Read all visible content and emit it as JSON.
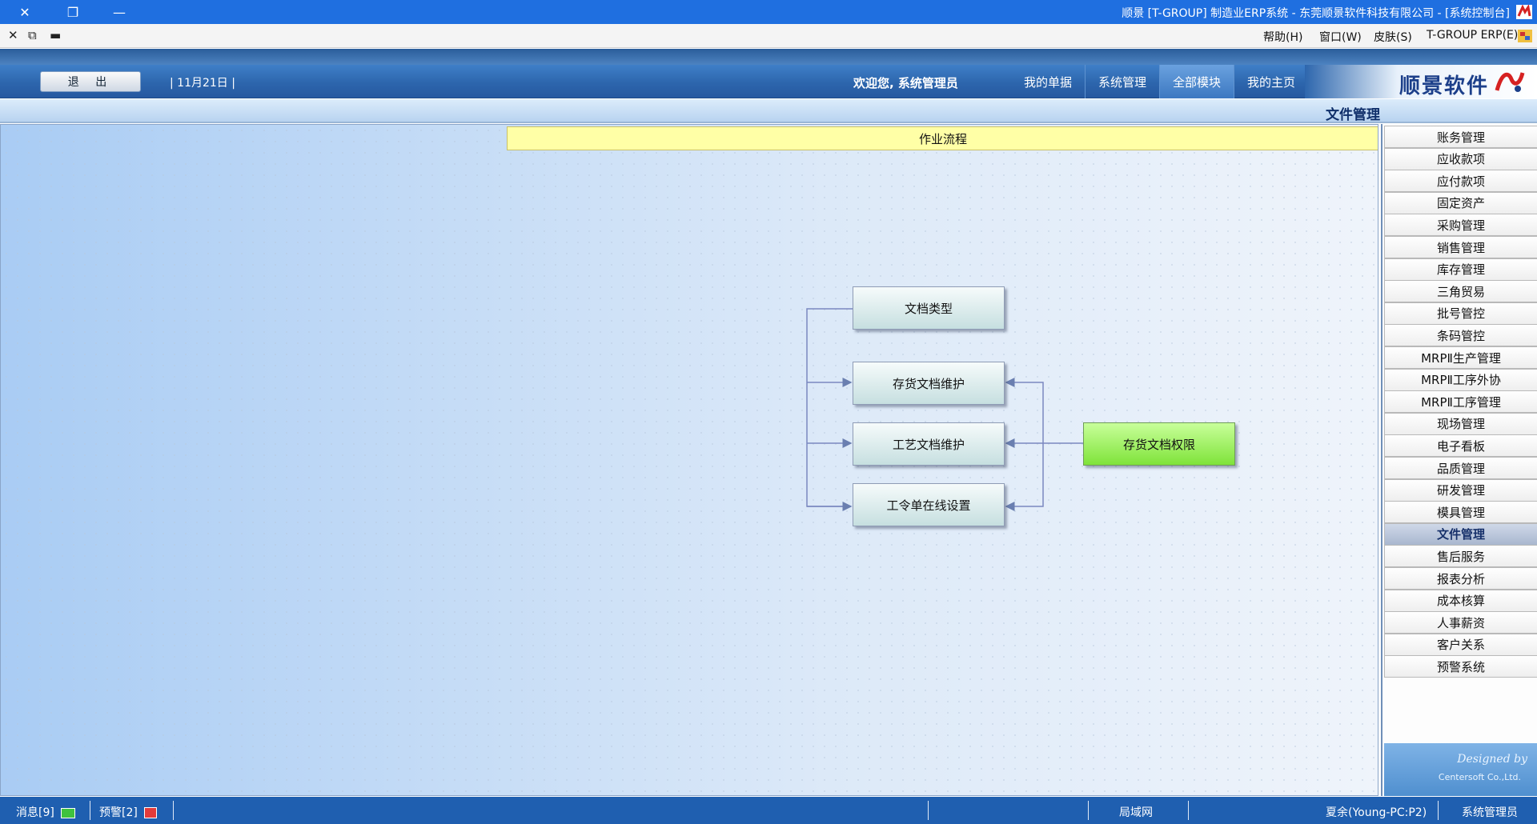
{
  "window": {
    "title": "顺景 [T-GROUP] 制造业ERP系统 - 东莞顺景软件科技有限公司 - [系统控制台]"
  },
  "menubar": {
    "items": [
      "T-GROUP ERP(E)",
      "皮肤(S)",
      "窗口(W)",
      "帮助(H)"
    ]
  },
  "nav": {
    "brand": "顺景软件",
    "tabs": [
      "我的主页",
      "全部模块",
      "系统管理",
      "我的单据"
    ],
    "active_tab": "全部模块",
    "welcome": "欢迎您, 系统管理员",
    "date": "11月21日",
    "logout": "退 出"
  },
  "section": {
    "title": "文件管理"
  },
  "flow": {
    "header": "作业流程",
    "nodes": {
      "doc_type": "文档类型",
      "stock_doc_maint": "存货文档维护",
      "process_doc_maint": "工艺文档维护",
      "workorder_online": "工令单在线设置",
      "stock_doc_perm": "存货文档权限"
    }
  },
  "right_menu": {
    "items": [
      "账务管理",
      "应收款项",
      "应付款项",
      "固定资产",
      "采购管理",
      "销售管理",
      "库存管理",
      "三角贸易",
      "批号管控",
      "条码管控",
      "MRPⅡ生产管理",
      "MRPⅡ工序外协",
      "MRPⅡ工序管理",
      "现场管理",
      "电子看板",
      "品质管理",
      "研发管理",
      "模具管理",
      "文件管理",
      "售后服务",
      "报表分析",
      "成本核算",
      "人事薪资",
      "客户关系",
      "预警系统"
    ],
    "active": "文件管理",
    "designed_by": "Designed by",
    "company": "Centersoft Co.,Ltd."
  },
  "statusbar": {
    "user": "系统管理员",
    "machine": "夏余(Young-PC:P2)",
    "network": "局域网",
    "alerts": "预警[2]",
    "messages": "消息[9]"
  },
  "colors": {
    "titlebar": "#1f6fe0",
    "accent_green": "#7fe33a",
    "flow_header": "#ffffa6"
  }
}
